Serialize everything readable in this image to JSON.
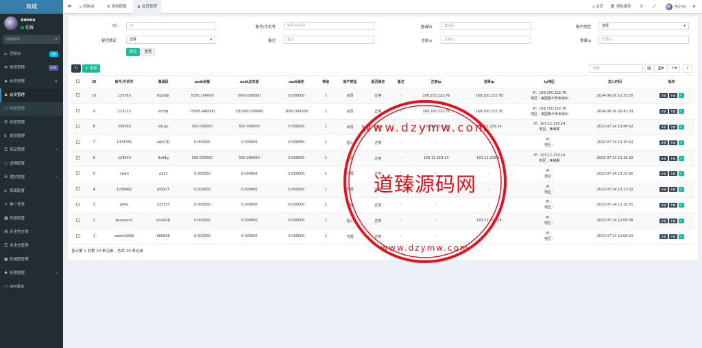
{
  "sidebar": {
    "brand": "商城",
    "user_name": "Admin",
    "user_status": "在线",
    "search_placeholder": "搜索菜单",
    "items": [
      {
        "label": "控制台",
        "icon": "dashboard-icon",
        "badge": "hot",
        "badge_color": "#00c0ef"
      },
      {
        "label": "常规管理",
        "icon": "cog-icon",
        "badge": "new",
        "badge_color": "#605ca8"
      },
      {
        "label": "会员管理",
        "icon": "user-icon",
        "chevron": "∨"
      },
      {
        "label": "会员管理",
        "icon": "user-icon",
        "active": true
      },
      {
        "label": "收益管理",
        "icon": "circle-icon",
        "sub": true
      },
      {
        "label": "充值管理",
        "icon": "list-icon"
      },
      {
        "label": "提现管理",
        "icon": "dollar-icon"
      },
      {
        "label": "商品管理",
        "icon": "list-icon",
        "chevron": "‹"
      },
      {
        "label": "返佣配置",
        "icon": "circle-icon"
      },
      {
        "label": "理财管理",
        "icon": "list-icon",
        "chevron": "‹"
      },
      {
        "label": "首面配置",
        "icon": "home-icon"
      },
      {
        "label": "推广任务",
        "icon": "share-icon"
      },
      {
        "label": "充值配置",
        "icon": "grid-icon"
      },
      {
        "label": "多语言分类",
        "icon": "tag-icon"
      },
      {
        "label": "多语言管理",
        "icon": "list-icon"
      },
      {
        "label": "轮播图管理",
        "icon": "image-icon"
      },
      {
        "label": "权限管理",
        "icon": "group-icon",
        "chevron": "‹"
      },
      {
        "label": "APP版本",
        "icon": "circle-icon"
      }
    ]
  },
  "topbar": {
    "tabs": [
      {
        "label": "控制台",
        "icon": "dashboard-icon"
      },
      {
        "label": "系统配置",
        "icon": "cog-icon"
      },
      {
        "label": "会员管理",
        "icon": "user-icon",
        "active": true
      }
    ],
    "home_label": "主页",
    "clear_cache_label": "清除缓存",
    "user_label": "Admin"
  },
  "filters": {
    "id_label": "ID",
    "id_placeholder": "ID",
    "account_label": "账号/手机号",
    "account_placeholder": "账号/手机号",
    "invite_label": "邀请码",
    "invite_placeholder": "邀请码",
    "acct_type_label": "账户类型",
    "acct_type_value": "选择",
    "locked_label": "是否锁定",
    "locked_value": "选择",
    "remark_label": "备注",
    "remark_placeholder": "备注",
    "reg_ip_label": "注册ip",
    "reg_ip_placeholder": "注册ip",
    "login_ip_label": "登录ip",
    "login_ip_placeholder": "登录ip",
    "submit_label": "提交",
    "reset_label": "重置"
  },
  "toolbar": {
    "refresh_icon": "refresh-icon",
    "add_label": "+ 添加",
    "search_placeholder": "搜索"
  },
  "table": {
    "headers": [
      "",
      "ID",
      "账号/手机号",
      "邀请码",
      "usdt余额",
      "usdt总充值",
      "usdt锁定",
      "等级",
      "账户类型",
      "是否锁定",
      "备注",
      "注册ip",
      "登录ip",
      "ip地区",
      "加入时间",
      "操作"
    ],
    "rows": [
      {
        "id": "10",
        "account": "123789",
        "invite": "6tpri9k",
        "usdt": "5170.160000",
        "usdt_total": "5000.000000",
        "usdt_lock": "0.000000",
        "level": "1",
        "type": "会员",
        "locked": "正常",
        "remark": "-",
        "reg_ip": "169.150.222.76",
        "login_ip": "169.150.222.76",
        "ip_line1": "IP：169.150.222.76",
        "ip_line2": "地区：美国南卡罗来纳州",
        "joined": "2024-06-16 10:25:25"
      },
      {
        "id": "9",
        "account": "123123",
        "invite": "sccfdj",
        "usdt": "75006.440000",
        "usdt_total": "-515000.000000",
        "usdt_lock": "1000.000000",
        "level": "1",
        "type": "会员",
        "locked": "正常",
        "remark": "-",
        "reg_ip": "169.150.222.76",
        "login_ip": "169.150.222.76",
        "ip_line1": "IP：169.150.222.76",
        "ip_line2": "地区：美国南卡罗来纳州",
        "joined": "2024-06-16 02:41:33"
      },
      {
        "id": "8",
        "account": "258369",
        "invite": "vle1pi",
        "usdt": "500.000000",
        "usdt_total": "500.000000",
        "usdt_lock": "0.000000",
        "level": "1",
        "type": "会员",
        "locked": "正常",
        "remark": "-",
        "reg_ip": "103.11.219.14",
        "login_ip": "103.11.219.14",
        "ip_line1": "IP：103.11.219.14",
        "ip_line2": "地区：柬埔寨",
        "joined": "2023-07-24 13:46:52"
      },
      {
        "id": "7",
        "account": "1472581",
        "invite": "eq2CfQ",
        "usdt": "0.000000",
        "usdt_total": "0.000000",
        "usdt_lock": "0.000000",
        "level": "1",
        "type": "個人",
        "locked": "正常",
        "remark": "-",
        "reg_ip": "-",
        "login_ip": "-",
        "ip_line1": "IP：",
        "ip_line2": "地区：",
        "joined": "2023-07-24 13:35:32"
      },
      {
        "id": "6",
        "account": "123649",
        "invite": "4xfi4g",
        "usdt": "500.000000",
        "usdt_total": "500.000000",
        "usdt_lock": "0.000000",
        "level": "1",
        "type": "会员",
        "locked": "正常",
        "remark": "-",
        "reg_ip": "103.11.219.14",
        "login_ip": "103.11.219.14",
        "ip_line1": "IP：103.11.219.14",
        "ip_line2": "地区：柬埔寨",
        "joined": "2023-07-24 13:28:32"
      },
      {
        "id": "5",
        "account": "ceshi",
        "invite": "a123",
        "usdt": "0.000000",
        "usdt_total": "0.000000",
        "usdt_lock": "0.000000",
        "level": "1",
        "type": "代理",
        "locked": "正常",
        "remark": "-",
        "reg_ip": "-",
        "login_ip": "-",
        "ip_line1": "IP：",
        "ip_line2": "地区：",
        "joined": "2023-07-24 13:25:00"
      },
      {
        "id": "4",
        "account": "1236491",
        "invite": "ArOXcT",
        "usdt": "0.000000",
        "usdt_total": "0.000000",
        "usdt_lock": "0.000000",
        "level": "1",
        "type": "代理",
        "locked": "正常",
        "remark": "-",
        "reg_ip": "-",
        "login_ip": "-",
        "ip_line1": "IP：",
        "ip_line2": "地区：",
        "joined": "2023-07-24 13:13:32"
      },
      {
        "id": "3",
        "account": "jinhu",
        "invite": "333333",
        "usdt": "0.000000",
        "usdt_total": "0.000000",
        "usdt_lock": "0.000000",
        "level": "2",
        "type": "代理",
        "locked": "正常",
        "remark": "-",
        "reg_ip": "-",
        "login_ip": "-",
        "ip_line1": "IP：",
        "ip_line2": "地区：",
        "joined": "2023-07-24 12:28:31"
      },
      {
        "id": "2",
        "account": "wuyanzu1",
        "invite": "sGxQ4R",
        "usdt": "0.000000",
        "usdt_total": "0.000000",
        "usdt_lock": "0.000000",
        "level": "1",
        "type": "個人",
        "locked": "正常",
        "remark": "-",
        "reg_ip": "-",
        "login_ip": "103.11.219.14",
        "ip_line1": "IP：",
        "ip_line2": "地区：",
        "joined": "2023-07-24 12:08:38"
      },
      {
        "id": "1",
        "account": "admin3366",
        "invite": "666666",
        "usdt": "0.000000",
        "usdt_total": "0.000000",
        "usdt_lock": "0.000000",
        "level": "1",
        "type": "代理",
        "locked": "正常",
        "remark": "-",
        "reg_ip": "-",
        "login_ip": "-",
        "ip_line1": "IP：",
        "ip_line2": "地区：",
        "joined": "2023-07-24 12:08:23"
      }
    ],
    "op_labels": [
      "详情",
      "余额"
    ],
    "edit_icon": "pencil-icon"
  },
  "footer_info": "显示第 1 到第 10 条记录，总共 10 条记录",
  "watermark": {
    "text": "道臻源码网",
    "url_top": "www.dzymw.com",
    "url_bottom": "www.dzymw.com",
    "color": "#e0141e"
  }
}
